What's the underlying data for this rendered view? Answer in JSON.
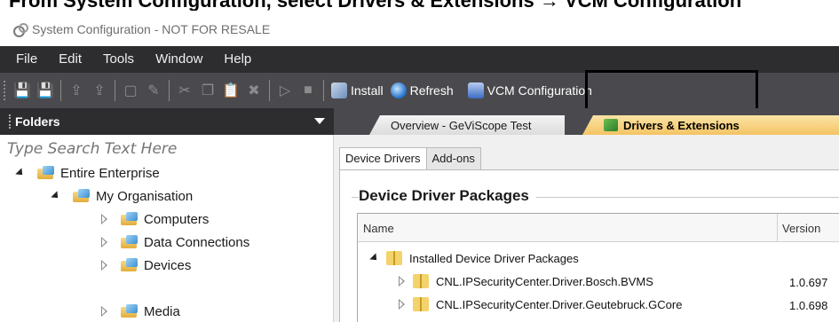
{
  "heading_fragment": "From System Configuration, select Drivers & Extensions → VCM Configuration",
  "window": {
    "title": "System Configuration - NOT FOR RESALE"
  },
  "menu": {
    "items": [
      "File",
      "Edit",
      "Tools",
      "Window",
      "Help"
    ]
  },
  "toolbar": {
    "install_label": "Install",
    "refresh_label": "Refresh",
    "vcm_label": "VCM Configuration",
    "highlight_color": "#000000"
  },
  "folders": {
    "title": "Folders",
    "search_placeholder": "Type Search Text Here",
    "items": [
      {
        "label": "Entire Enterprise",
        "expanded": true
      },
      {
        "label": "My Organisation",
        "expanded": true
      },
      {
        "label": "Computers",
        "expanded": false
      },
      {
        "label": "Data Connections",
        "expanded": false
      },
      {
        "label": "Devices",
        "expanded": false
      },
      {
        "label": "Media",
        "expanded": false
      }
    ]
  },
  "tabs": {
    "overview": "Overview - GeViScope Test",
    "drivers": "Drivers & Extensions"
  },
  "subtabs": {
    "device_drivers": "Device Drivers",
    "addons": "Add-ons"
  },
  "group": {
    "title": "Device Driver Packages"
  },
  "grid": {
    "columns": {
      "name": "Name",
      "version": "Version"
    },
    "rows": [
      {
        "name": "Installed Device Driver Packages",
        "version": "",
        "expanded": true
      },
      {
        "name": "CNL.IPSecurityCenter.Driver.Bosch.BVMS",
        "version": "1.0.697"
      },
      {
        "name": "CNL.IPSecurityCenter.Driver.Geutebruck.GCore",
        "version": "1.0.698"
      }
    ]
  },
  "colors": {
    "menubar_bg": "#2d2d30",
    "toolbar_bg": "#4a4a4e",
    "active_tab": "#f3c463"
  }
}
